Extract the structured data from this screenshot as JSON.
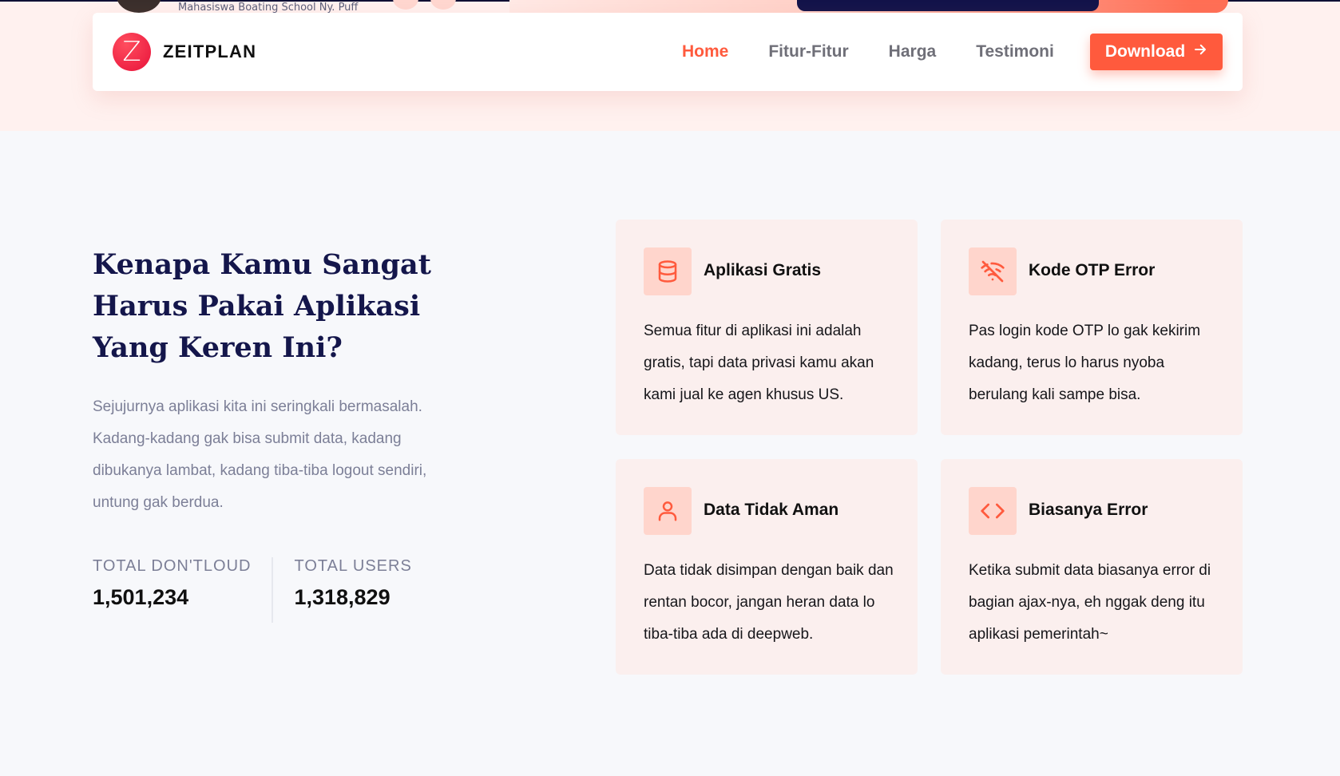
{
  "hero": {
    "caption": "Mahasiswa Boating School Ny. Puff"
  },
  "navbar": {
    "brand": {
      "logo_letter": "Z",
      "name": "ZEITPLAN"
    },
    "links": [
      {
        "label": "Home",
        "active": true
      },
      {
        "label": "Fitur-Fitur",
        "active": false
      },
      {
        "label": "Harga",
        "active": false
      },
      {
        "label": "Testimoni",
        "active": false
      }
    ],
    "download_label": "Download",
    "download_arrow": "→"
  },
  "why": {
    "title": "Kenapa Kamu Sangat Harus Pakai Aplikasi Yang Keren Ini?",
    "description": "Sejujurnya aplikasi kita ini seringkali bermasalah. Kadang-kadang gak bisa submit data, kadang dibukanya lambat, kadang tiba-tiba logout sendiri, untung gak berdua.",
    "stats": [
      {
        "label": "TOTAL DON'TLOUD",
        "value": "1,501,234"
      },
      {
        "label": "TOTAL USERS",
        "value": "1,318,829"
      }
    ]
  },
  "features": [
    {
      "icon": "database-icon",
      "title": "Aplikasi Gratis",
      "text": "Semua fitur di aplikasi ini adalah gratis, tapi data privasi kamu akan kami jual ke agen khusus US."
    },
    {
      "icon": "wifi-off-icon",
      "title": "Kode OTP Error",
      "text": "Pas login kode OTP lo gak kekirim kadang, terus lo harus nyoba berulang kali sampe bisa."
    },
    {
      "icon": "user-icon",
      "title": "Data Tidak Aman",
      "text": "Data tidak disimpan dengan baik dan rentan bocor, jangan heran data lo tiba-tiba ada di deepweb."
    },
    {
      "icon": "code-icon",
      "title": "Biasanya Error",
      "text": "Ketika submit data biasanya error di bagian ajax-nya, eh nggak deng itu aplikasi pemerintah~"
    }
  ],
  "colors": {
    "accent": "#ff5a3d",
    "heading": "#14164b",
    "card_bg": "#fbefee",
    "icon_bg": "#ffd5cc"
  }
}
